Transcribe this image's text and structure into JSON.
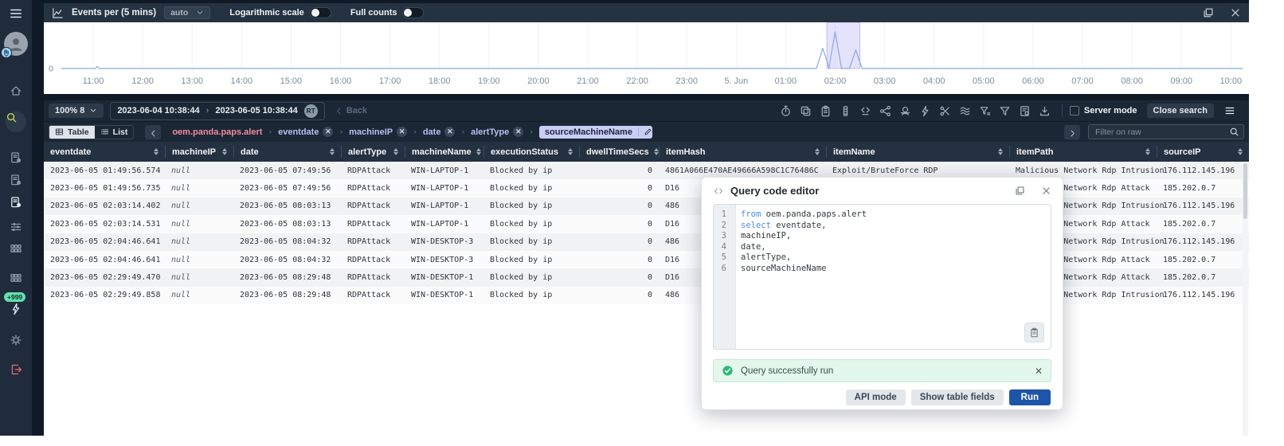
{
  "sidebar": {
    "badge": "+999",
    "items": [
      {
        "icon": "home-icon",
        "active": false
      },
      {
        "icon": "search-icon",
        "active": true
      },
      {
        "icon": "incident-report-icon",
        "bright": false
      },
      {
        "icon": "incident-report-icon",
        "bright": false
      },
      {
        "icon": "incident-report-icon",
        "bright": true
      },
      {
        "icon": "sliders-icon",
        "bright": false
      },
      {
        "icon": "apps-grid-icon",
        "bright": false
      },
      {
        "icon": "apps-grid-icon",
        "bright": false
      },
      {
        "icon": "zap-icon",
        "bright": true,
        "badge": "+999"
      },
      {
        "icon": "gear-icon",
        "bright": false
      },
      {
        "icon": "logout-icon",
        "red": true
      }
    ]
  },
  "chart_panel": {
    "title": "Events per (5 mins)",
    "interval": "auto",
    "log_label": "Logarithmic scale",
    "full_label": "Full counts",
    "log_on": false,
    "full_on": false
  },
  "chart_data": {
    "type": "line",
    "title": "Events per (5 mins)",
    "interval": "auto",
    "y_base_label": "0",
    "baseline_value": 0,
    "x_ticks": [
      "11:00",
      "12:00",
      "13:00",
      "14:00",
      "15:00",
      "16:00",
      "17:00",
      "18:00",
      "19:00",
      "20:00",
      "21:00",
      "22:00",
      "23:00",
      "5. Jun",
      "01:00",
      "02:00",
      "03:00",
      "04:00",
      "05:00",
      "06:00",
      "07:00",
      "08:00",
      "09:00",
      "10:00"
    ],
    "minor_activity": [
      {
        "time": "11:05",
        "rel_height": 0.06
      }
    ],
    "spikes": [
      {
        "time": "01:45",
        "rel_height": 0.55
      },
      {
        "time": "02:00",
        "rel_height": 1.0
      },
      {
        "time": "02:25",
        "rel_height": 0.5
      }
    ],
    "selection_window": {
      "from": "01:50",
      "to": "02:30"
    },
    "line_color": "#84abe3",
    "selection_fill": "rgba(168,160,246,0.30)",
    "selection_stroke": "rgba(148,138,240,0.55)",
    "grid": true,
    "legend": "none"
  },
  "toolbar": {
    "zoom_label": "100% 8",
    "date_from": "2023-06-04 10:38:44",
    "date_to": "2023-06-05 10:38:44",
    "rt_badge": "RT",
    "back_label": "Back",
    "server_mode_label": "Server mode",
    "close_search_label": "Close search",
    "icon_names": [
      "history-timer-icon",
      "copy-table-icon",
      "clipboard-icon",
      "column-view-icon",
      "code-snippet-icon",
      "chart-relation-icon",
      "incognito-icon",
      "zap-fields-icon",
      "scissors-icon",
      "stream-icon",
      "filter-values-icon",
      "filter-icon",
      "export-file-icon",
      "download-icon"
    ]
  },
  "breadcrumb": {
    "view_table": "Table",
    "view_list": "List",
    "source": "oem.panda.paps.alert",
    "fields": [
      "eventdate",
      "machineIP",
      "date",
      "alertType"
    ],
    "active_field": "sourceMachineName",
    "filter_placeholder": "Filter on raw"
  },
  "table": {
    "columns": [
      "eventdate",
      "machineIP",
      "date",
      "alertType",
      "machineName",
      "executionStatus",
      "dwellTimeSecs",
      "itemHash",
      "itemName",
      "itemPath",
      "sourceIP"
    ],
    "rows": [
      [
        "2023-06-05 01:49:56.574",
        "null",
        "2023-06-05 07:49:56",
        "RDPAttack",
        "WIN-LAPTOP-1",
        "Blocked by ip",
        "0",
        "4861A066E470AE49666A598C1C76486C",
        "Exploit/BruteForce RDP",
        "Malicious Network Rdp Intrusion",
        "176.112.145.196"
      ],
      [
        "2023-06-05 01:49:56.735",
        "null",
        "2023-06-05 07:49:56",
        "RDPAttack",
        "WIN-LAPTOP-1",
        "Blocked by ip",
        "0",
        "D16",
        "",
        "Malicious Network Rdp Attack",
        "185.202.0.7"
      ],
      [
        "2023-06-05 02:03:14.402",
        "null",
        "2023-06-05 08:03:13",
        "RDPAttack",
        "WIN-LAPTOP-1",
        "Blocked by ip",
        "0",
        "486",
        "",
        "Malicious Network Rdp Intrusion",
        "176.112.145.196"
      ],
      [
        "2023-06-05 02:03:14.531",
        "null",
        "2023-06-05 08:03:13",
        "RDPAttack",
        "WIN-LAPTOP-1",
        "Blocked by ip",
        "0",
        "D16",
        "",
        "Malicious Network Rdp Attack",
        "185.202.0.7"
      ],
      [
        "2023-06-05 02:04:46.641",
        "null",
        "2023-06-05 08:04:32",
        "RDPAttack",
        "WIN-DESKTOP-3",
        "Blocked by ip",
        "0",
        "486",
        "",
        "Malicious Network Rdp Intrusion",
        "176.112.145.196"
      ],
      [
        "2023-06-05 02:04:46.641",
        "null",
        "2023-06-05 08:04:32",
        "RDPAttack",
        "WIN-DESKTOP-3",
        "Blocked by ip",
        "0",
        "D16",
        "",
        "Malicious Network Rdp Attack",
        "185.202.0.7"
      ],
      [
        "2023-06-05 02:29:49.470",
        "null",
        "2023-06-05 08:29:48",
        "RDPAttack",
        "WIN-DESKTOP-1",
        "Blocked by ip",
        "0",
        "D16",
        "",
        "Malicious Network Rdp Attack",
        "185.202.0.7"
      ],
      [
        "2023-06-05 02:29:49.858",
        "null",
        "2023-06-05 08:29:48",
        "RDPAttack",
        "WIN-DESKTOP-1",
        "Blocked by ip",
        "0",
        "486",
        "",
        "Malicious Network Rdp Intrusion",
        "176.112.145.196"
      ]
    ]
  },
  "modal": {
    "title": "Query code editor",
    "code_lines": [
      {
        "n": 1,
        "kw": "from",
        "code": "oem.panda.paps.alert"
      },
      {
        "n": 2,
        "kw": "select",
        "code": "eventdate,"
      },
      {
        "n": 3,
        "kw": "",
        "code": "machineIP,"
      },
      {
        "n": 4,
        "kw": "",
        "code": "date,"
      },
      {
        "n": 5,
        "kw": "",
        "code": "alertType,"
      },
      {
        "n": 6,
        "kw": "",
        "code": "sourceMachineName"
      }
    ],
    "success_message": "Query successfully run",
    "api_button": "API mode",
    "fields_button": "Show table fields",
    "run_button": "Run"
  }
}
